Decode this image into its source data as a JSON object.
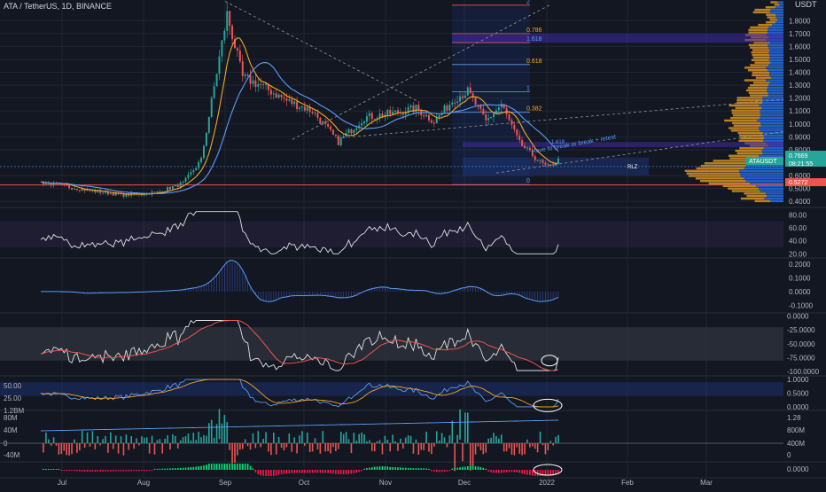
{
  "header": {
    "title": "ATA / TetherUS, 1D, BINANCE",
    "unit": "USDT"
  },
  "colors": {
    "background": "#131722",
    "grid": "#1f2433",
    "text": "#b2b5be",
    "up": "#26a69a",
    "down": "#ef5350",
    "blue_line": "#5b9cf6",
    "orange_line": "#f5a623",
    "white_line": "#e0e0e0"
  },
  "chart_data": [
    {
      "type": "candlestick",
      "id": "price",
      "yaxis_ticks": [
        "1.8000",
        "1.7000",
        "1.6000",
        "1.5000",
        "1.4000",
        "1.3000",
        "1.2000",
        "1.1000",
        "1.0000",
        "0.9000",
        "0.8000",
        "0.6000",
        "0.5000",
        "0.4000"
      ],
      "ylim": [
        0.36,
        1.96
      ],
      "price_labels": [
        {
          "text": "ATAUSDT",
          "color": "#26a69a"
        },
        {
          "text": "0.7669",
          "color": "#26a69a"
        },
        {
          "text": "08:21:55",
          "color": "#26a69a"
        },
        {
          "text": "0.5272",
          "color": "#ef5350"
        }
      ],
      "fib_levels": [
        {
          "label": "2",
          "value": 1.92
        },
        {
          "label": "0.786",
          "value": 1.7
        },
        {
          "label": "1.618",
          "value": 1.63
        },
        {
          "label": "0.618",
          "value": 1.46
        },
        {
          "label": "1",
          "value": 1.25
        },
        {
          "label": "0.382",
          "value": 1.09
        },
        {
          "label": "0",
          "value": 0.53
        }
      ],
      "annotations": [
        "Have to break or break + retest",
        "RLZ",
        "1.618"
      ],
      "x_tick_labels": [
        "Jul",
        "Aug",
        "Sep",
        "Oct",
        "Nov",
        "Dec",
        "2022",
        "Feb",
        "Mar"
      ]
    },
    {
      "type": "line",
      "id": "rsi",
      "yaxis_ticks": [
        "80.00",
        "60.00",
        "40.00",
        "20.00"
      ],
      "ylim": [
        15,
        90
      ],
      "band": [
        30,
        70
      ]
    },
    {
      "type": "area",
      "id": "oscillator",
      "yaxis_ticks": [
        "0.2000",
        "0.1000",
        "0.0000",
        "-0.1000"
      ],
      "ylim": [
        -0.15,
        0.24
      ]
    },
    {
      "type": "line",
      "id": "williams",
      "yaxis_ticks": [
        "0.0000",
        "-25.0000",
        "-50.0000",
        "-75.0000",
        "-100.0000"
      ],
      "ylim": [
        -106,
        4
      ],
      "band": [
        -80,
        -20
      ]
    },
    {
      "type": "line",
      "id": "stoch",
      "yaxis_ticks": [
        "1.0000",
        "0.5000",
        "0.0000"
      ],
      "left_ticks": [
        "50.00",
        "25.00"
      ],
      "ylim": [
        -0.1,
        1.1
      ]
    },
    {
      "type": "bar",
      "id": "volume",
      "yaxis_ticks": [
        "1.2B",
        "800M",
        "400M",
        "0"
      ],
      "right_ticks": [
        "1.28",
        "800M",
        "400M",
        "0"
      ],
      "left_ticks": [
        "1.2BM",
        "80M",
        "40M",
        "0",
        "-40M"
      ]
    },
    {
      "type": "bar",
      "id": "histogram",
      "yaxis_ticks": [
        "0.0000"
      ]
    }
  ]
}
